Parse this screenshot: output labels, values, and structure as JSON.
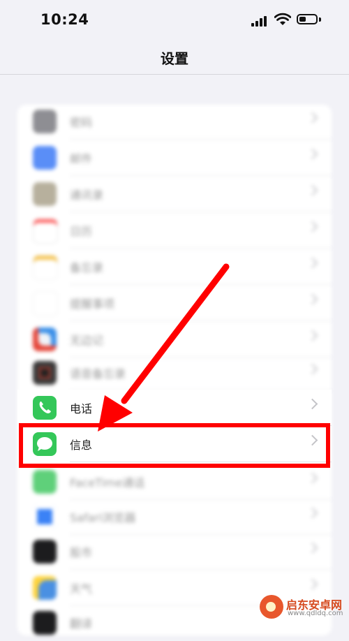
{
  "status_bar": {
    "time": "10:24"
  },
  "nav": {
    "title": "设置"
  },
  "rows": [
    {
      "label": "密码"
    },
    {
      "label": "邮件"
    },
    {
      "label": "通讯录"
    },
    {
      "label": "日历"
    },
    {
      "label": "备忘录"
    },
    {
      "label": "提醒事项"
    },
    {
      "label": "无边记"
    },
    {
      "label": "语音备忘录"
    },
    {
      "label": "电话"
    },
    {
      "label": "信息"
    },
    {
      "label": "FaceTime通话"
    },
    {
      "label": "Safari浏览器"
    },
    {
      "label": "股市"
    },
    {
      "label": "天气"
    },
    {
      "label": "翻译"
    }
  ],
  "colors": {
    "accent_red": "#ff0000",
    "messages_green": "#34c759"
  },
  "watermark": {
    "title": "启东安卓网",
    "url": "www.qdldq.com"
  }
}
